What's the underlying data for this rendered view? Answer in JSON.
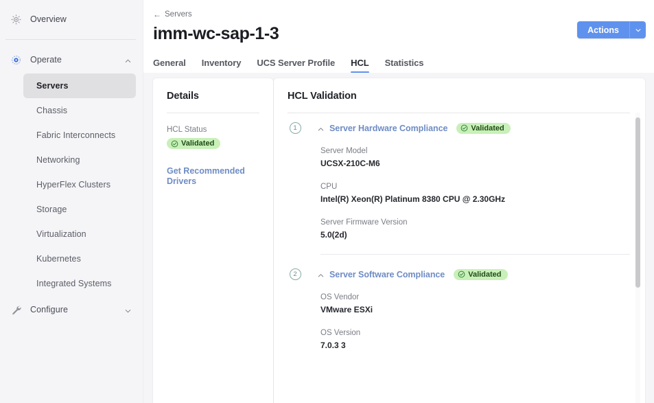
{
  "sidebar": {
    "top_item": {
      "label": "Overview",
      "icon": "dashboard-gauge-icon"
    },
    "groups": [
      {
        "label": "Operate",
        "icon": "operate-gear-icon",
        "expanded": true,
        "chevron": "chevron-up-icon",
        "items": [
          {
            "label": "Servers",
            "active": true
          },
          {
            "label": "Chassis",
            "active": false
          },
          {
            "label": "Fabric Interconnects",
            "active": false
          },
          {
            "label": "Networking",
            "active": false
          },
          {
            "label": "HyperFlex Clusters",
            "active": false
          },
          {
            "label": "Storage",
            "active": false
          },
          {
            "label": "Virtualization",
            "active": false
          },
          {
            "label": "Kubernetes",
            "active": false
          },
          {
            "label": "Integrated Systems",
            "active": false
          }
        ]
      },
      {
        "label": "Configure",
        "icon": "wrench-icon",
        "expanded": false,
        "chevron": "chevron-down-icon",
        "items": []
      }
    ]
  },
  "header": {
    "breadcrumb": {
      "arrow": "←",
      "label": "Servers"
    },
    "title": "imm-wc-sap-1-3",
    "actions": {
      "label": "Actions",
      "caret_icon": "chevron-down-icon",
      "color": "#5f92ee"
    }
  },
  "tabs": [
    {
      "label": "General",
      "active": false
    },
    {
      "label": "Inventory",
      "active": false
    },
    {
      "label": "UCS Server Profile",
      "active": false
    },
    {
      "label": "HCL",
      "active": true
    },
    {
      "label": "Statistics",
      "active": false
    }
  ],
  "details_card": {
    "title": "Details",
    "hcl_status_label": "HCL Status",
    "hcl_status_value": "Validated",
    "status_icon": "check-circle-icon",
    "status_bg": "#c8f0b8",
    "status_fg": "#1f4a17",
    "link_label": "Get Recommended Drivers"
  },
  "validation_card": {
    "title": "HCL Validation",
    "sections": [
      {
        "number": "1",
        "title": "Server Hardware Compliance",
        "caret_icon": "chevron-up-icon",
        "status": "Validated",
        "status_icon": "check-circle-icon",
        "fields": [
          {
            "label": "Server Model",
            "value": "UCSX-210C-M6"
          },
          {
            "label": "CPU",
            "value": "Intel(R) Xeon(R) Platinum 8380 CPU @ 2.30GHz"
          },
          {
            "label": "Server Firmware Version",
            "value": "5.0(2d)"
          }
        ]
      },
      {
        "number": "2",
        "title": "Server Software Compliance",
        "caret_icon": "chevron-up-icon",
        "status": "Validated",
        "status_icon": "check-circle-icon",
        "fields": [
          {
            "label": "OS Vendor",
            "value": "VMware ESXi"
          },
          {
            "label": "OS Version",
            "value": "7.0.3 3"
          }
        ]
      }
    ]
  }
}
